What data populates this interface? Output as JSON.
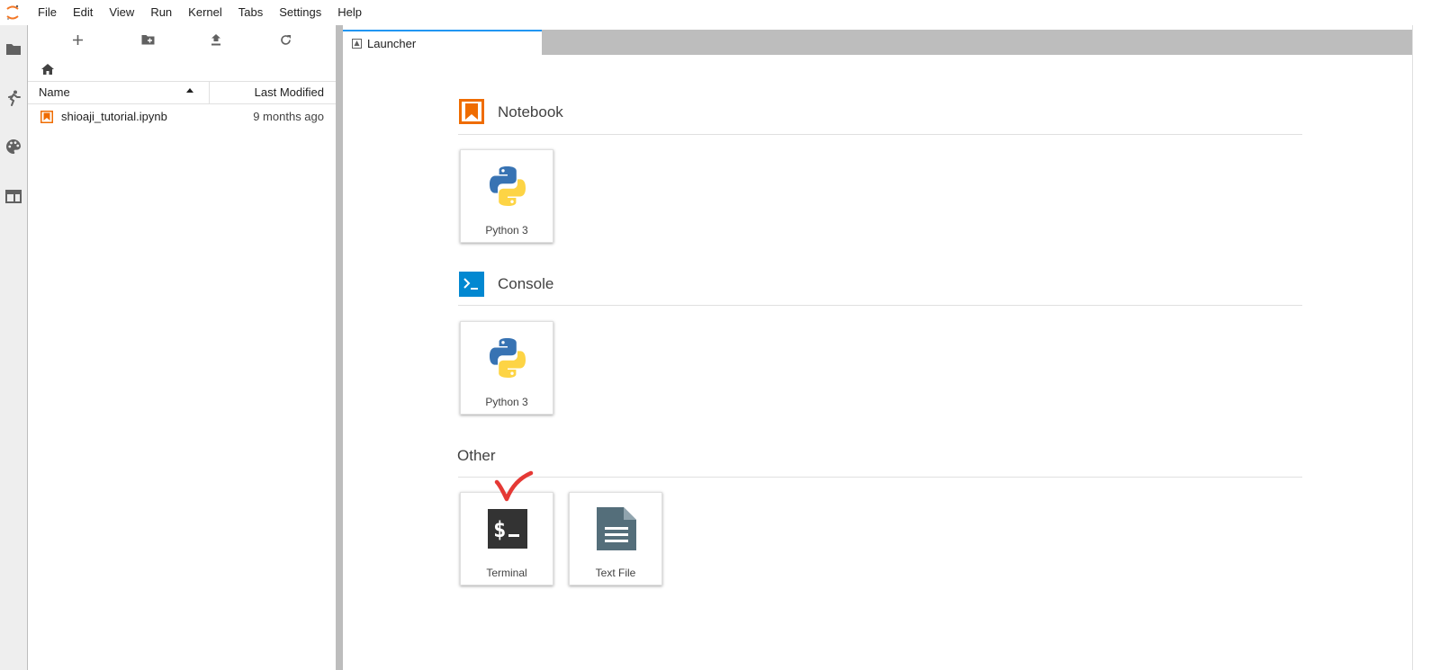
{
  "app": {
    "logo_icon": "jupyter-logo-icon",
    "accent_color": "#2196f3"
  },
  "menubar": {
    "items": [
      "File",
      "Edit",
      "View",
      "Run",
      "Kernel",
      "Tabs",
      "Settings",
      "Help"
    ]
  },
  "activity_bar": {
    "icons": [
      "folder-icon",
      "running-icon",
      "palette-icon",
      "tabs-icon"
    ]
  },
  "file_browser": {
    "toolbar_icons": [
      "new-launcher-icon",
      "new-folder-icon",
      "upload-icon",
      "refresh-icon"
    ],
    "breadcrumb_icon": "home-icon",
    "columns": {
      "name": "Name",
      "last_modified": "Last Modified"
    },
    "sort": "name-ascending",
    "files": [
      {
        "name": "shioaji_tutorial.ipynb",
        "modified": "9 months ago",
        "icon": "notebook-file-icon"
      }
    ]
  },
  "tabs": [
    {
      "label": "Launcher",
      "icon": "launcher-icon",
      "active": true
    }
  ],
  "launcher": {
    "sections": [
      {
        "title": "Notebook",
        "icon": "notebook-icon",
        "color": "#ef6c00",
        "cards": [
          {
            "label": "Python 3",
            "icon": "python-logo-icon"
          }
        ]
      },
      {
        "title": "Console",
        "icon": "console-icon",
        "color": "#0288d1",
        "cards": [
          {
            "label": "Python 3",
            "icon": "python-logo-icon"
          }
        ]
      },
      {
        "title": "Other",
        "icon": "",
        "cards": [
          {
            "label": "Terminal",
            "icon": "terminal-icon"
          },
          {
            "label": "Text File",
            "icon": "text-file-icon"
          }
        ]
      }
    ]
  },
  "annotation": {
    "icon": "red-checkmark-icon",
    "color": "#e53935"
  }
}
